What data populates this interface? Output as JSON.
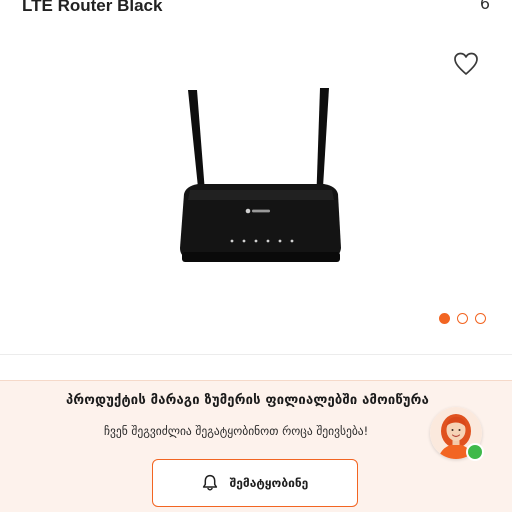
{
  "product": {
    "title": "LTE Router Black",
    "corner_glyph": "6"
  },
  "icons": {
    "wishlist": "heart-outline-icon",
    "bell": "bell-icon"
  },
  "gallery": {
    "total_images": 3,
    "active_index": 0
  },
  "notify": {
    "heading": "პროდუქტის მარაგი ზუმერის ფილიალებში ამოიწურა",
    "subtext": "ჩვენ შეგვიძლია შეგატყობინოთ როცა შეივსება!",
    "button_label": "შემატყობინე"
  },
  "colors": {
    "accent": "#f26522",
    "panel_bg": "#fdf2ec",
    "online": "#3fb94a"
  }
}
